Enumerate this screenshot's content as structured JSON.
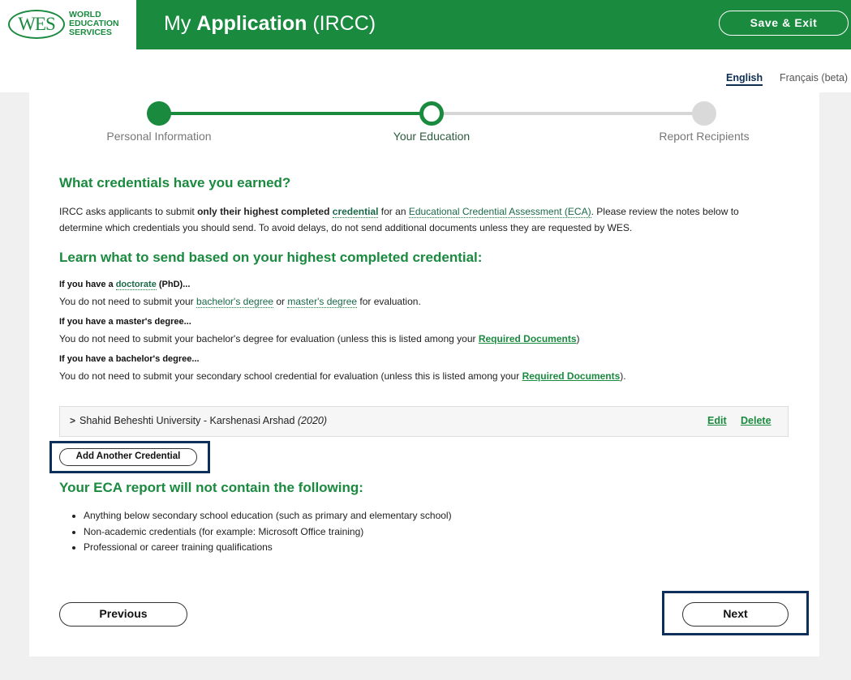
{
  "header": {
    "logo_mark": "WES",
    "logo_line1": "WORLD",
    "logo_line2": "EDUCATION",
    "logo_line3": "SERVICES",
    "title_prefix": "My ",
    "title_bold": "Application",
    "title_suffix": " (IRCC)",
    "save_exit_label": "Save & Exit",
    "brand_color": "#1a8a3f"
  },
  "language": {
    "english": "English",
    "french": "Français (beta)"
  },
  "stepper": {
    "steps": [
      {
        "label": "Personal Information",
        "status": "complete"
      },
      {
        "label": "Your Education",
        "status": "current"
      },
      {
        "label": "Report Recipients",
        "status": "upcoming"
      }
    ]
  },
  "credentials": {
    "heading": "What credentials have you earned?",
    "intro_1": "IRCC asks applicants to submit ",
    "intro_bold": "only their highest completed",
    "intro_2": " ",
    "intro_link_credential": "credential",
    "intro_3": " for an ",
    "intro_link_eca": "Educational Credential Assessment (ECA)",
    "intro_4": ". Please review the notes below to determine which credentials you should send. To avoid delays, do not send additional documents unless they are requested by WES."
  },
  "learn": {
    "heading": "Learn what to send based on your highest completed credential:",
    "doctorate_q_1": "If you have a ",
    "doctorate_q_link": "doctorate",
    "doctorate_q_2": " (PhD)...",
    "doctorate_a_1": "You do not need to submit your ",
    "doctorate_a_link1": "bachelor's degree",
    "doctorate_a_2": " or ",
    "doctorate_a_link2": "master's degree",
    "doctorate_a_3": " for evaluation.",
    "master_q": "If you have a master's degree...",
    "master_a_1": "You do not need to submit your bachelor's degree for evaluation (unless this is listed among your ",
    "master_a_link": "Required Documents",
    "master_a_2": ")",
    "bachelor_q": "If you have a bachelor's degree...",
    "bachelor_a_1": "You do not need to submit your secondary school credential for evaluation (unless this is listed among your ",
    "bachelor_a_link": "Required Documents",
    "bachelor_a_2": ")."
  },
  "credential_entry": {
    "caret": ">",
    "name": "Shahid Beheshti University - Karshenasi Arshad ",
    "year": "(2020)",
    "edit_label": "Edit",
    "delete_label": "Delete"
  },
  "add_credential_label": "Add Another Credential",
  "exclusions": {
    "heading": "Your ECA report will not contain the following:",
    "items": [
      "Anything below secondary school education (such as primary and elementary school)",
      "Non-academic credentials (for example: Microsoft Office training)",
      "Professional or career training qualifications"
    ]
  },
  "nav": {
    "previous_label": "Previous",
    "next_label": "Next"
  }
}
